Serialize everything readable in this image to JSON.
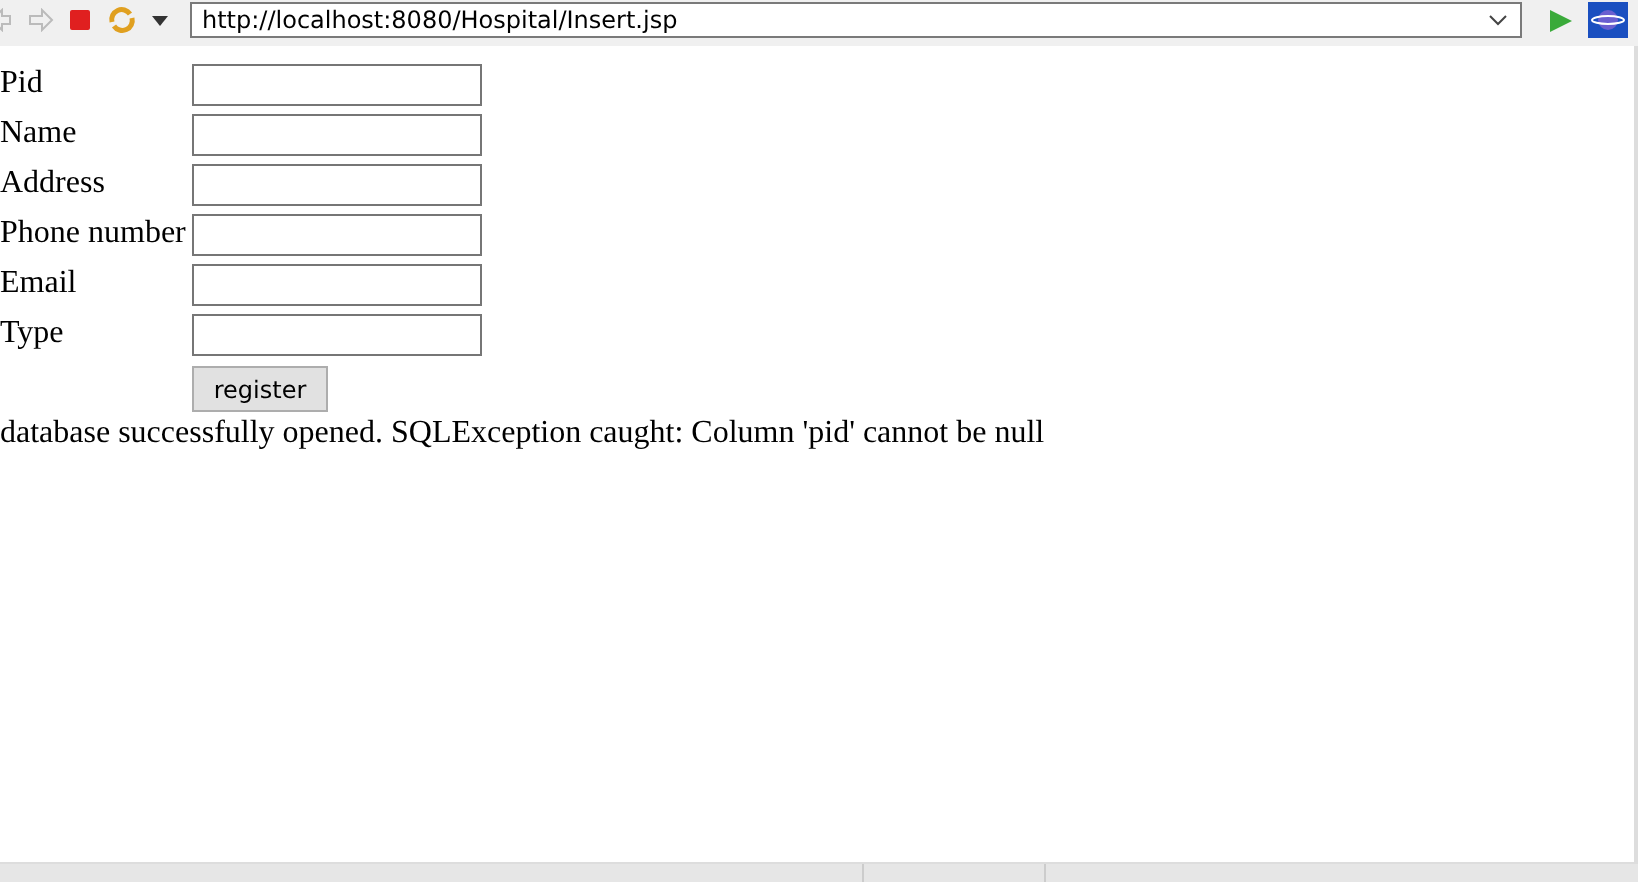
{
  "toolbar": {
    "url": "http://localhost:8080/Hospital/Insert.jsp"
  },
  "form": {
    "fields": [
      {
        "label": "Pid"
      },
      {
        "label": "Name"
      },
      {
        "label": "Address"
      },
      {
        "label": "Phone number"
      },
      {
        "label": "Email"
      },
      {
        "label": "Type"
      }
    ],
    "submit": "register"
  },
  "message": "database successfully opened. SQLException caught: Column 'pid' cannot be null"
}
